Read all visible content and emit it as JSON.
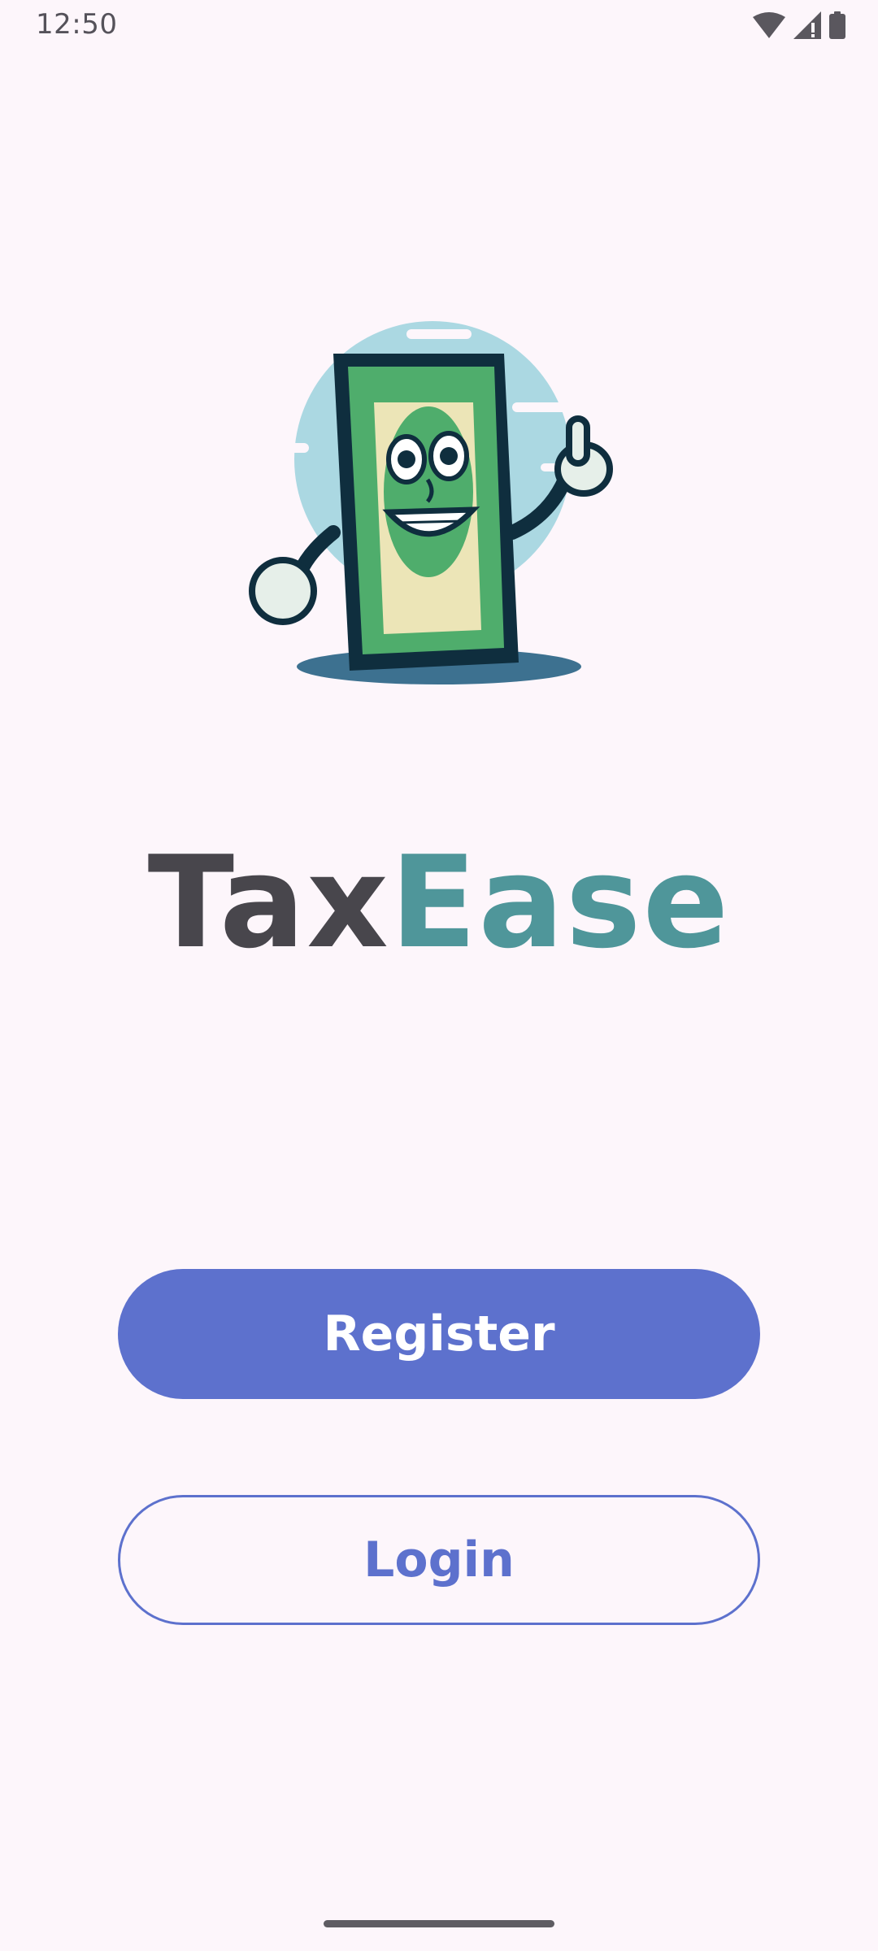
{
  "status_bar": {
    "time": "12:50",
    "icons": [
      "wifi-icon",
      "cellular-signal-icon",
      "battery-icon"
    ]
  },
  "splash": {
    "mascot_icon": "money-bill-mascot-thumbs-up",
    "title_part_1": "Tax",
    "title_part_2": "Ease"
  },
  "actions": {
    "register_label": "Register",
    "login_label": "Login"
  },
  "colors": {
    "background": "#fdf6fb",
    "accent": "#5d71cd",
    "title_dark": "#48464c",
    "title_teal": "#4f969a"
  }
}
